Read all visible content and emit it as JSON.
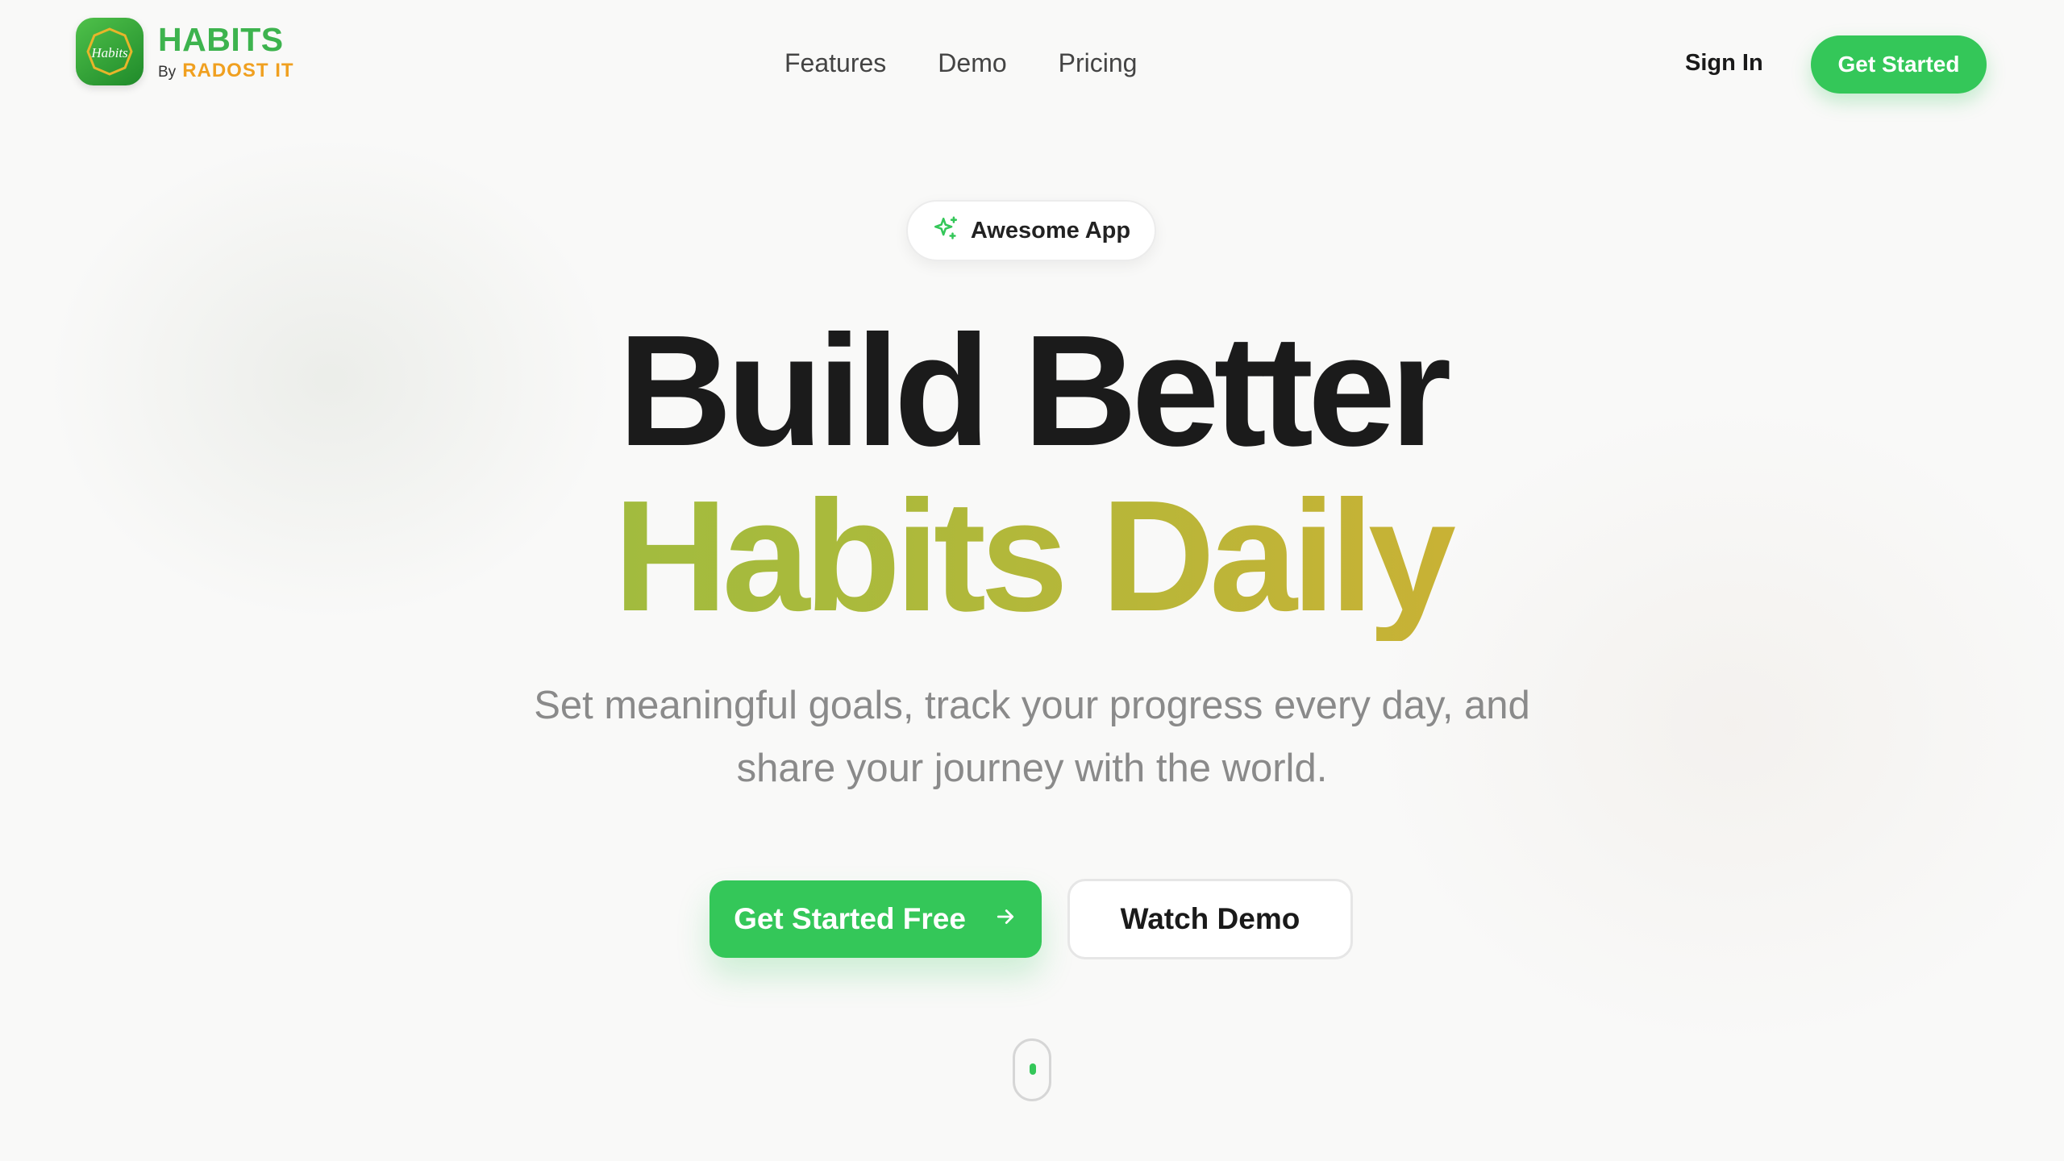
{
  "brand": {
    "name": "HABITS",
    "by_label": "By",
    "company": "RADOST IT",
    "logo_text": "Habits"
  },
  "nav": {
    "items": [
      {
        "label": "Features"
      },
      {
        "label": "Demo"
      },
      {
        "label": "Pricing"
      }
    ]
  },
  "header": {
    "signin_label": "Sign In",
    "cta_label": "Get Started"
  },
  "hero": {
    "badge_label": "Awesome App",
    "badge_icon": "sparkles-icon",
    "headline_line1": "Build Better",
    "headline_line2": "Habits Daily",
    "subtitle_line1": "Set meaningful goals, track your progress every day, and",
    "subtitle_line2": "share your journey with the world.",
    "primary_cta": "Get Started Free",
    "primary_cta_icon": "arrow-right-icon",
    "secondary_cta": "Watch Demo"
  },
  "colors": {
    "brand_green": "#34c759",
    "brand_orange": "#f0a020",
    "gradient_start": "#8dbf45",
    "gradient_end": "#e1a52e",
    "background": "#f9f9f8"
  }
}
